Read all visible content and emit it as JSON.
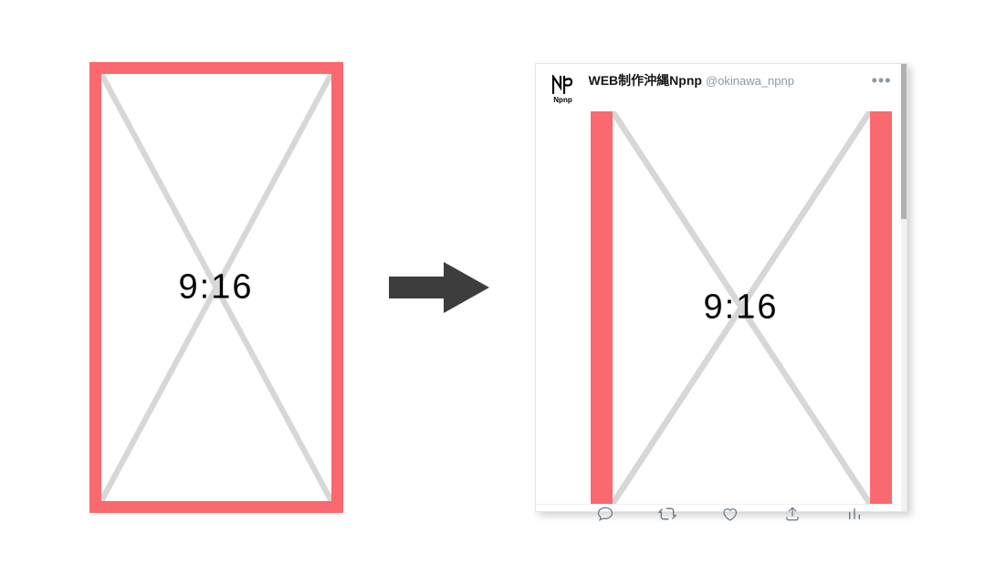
{
  "original": {
    "ratio_label": "9:16",
    "border_color": "#fa6970"
  },
  "arrow": {
    "color": "#3d3d3d"
  },
  "tweet": {
    "avatar_label": "Npnp",
    "display_name": "WEB制作沖縄Npnp",
    "handle": "@okinawa_npnp",
    "preview_ratio_label": "9:16",
    "crop_bar_color": "#fa6970",
    "actions": {
      "reply": "reply",
      "retweet": "retweet",
      "like": "like",
      "share": "share",
      "analytics": "analytics"
    }
  }
}
